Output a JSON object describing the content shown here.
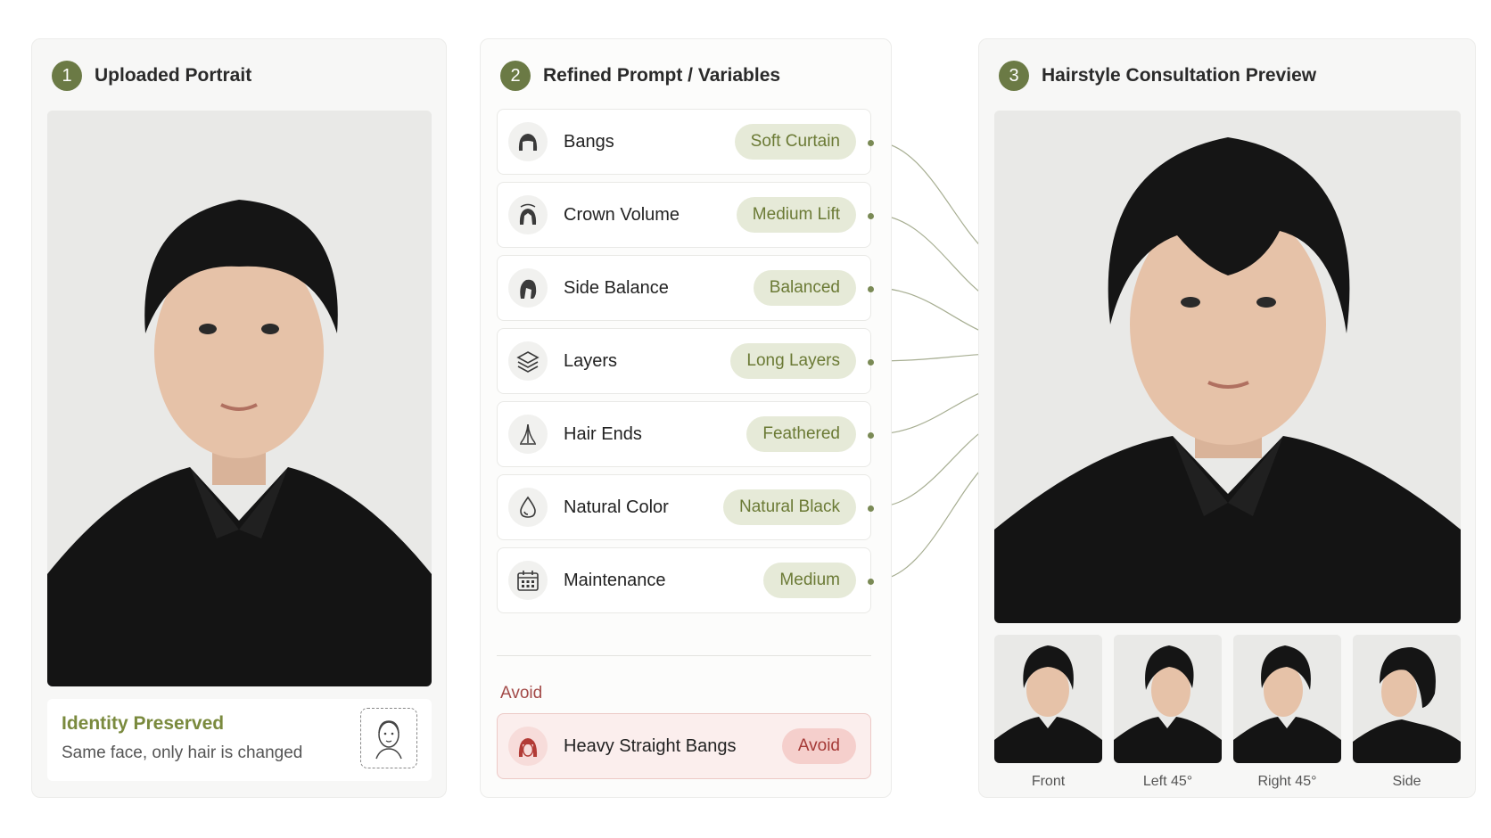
{
  "panels": {
    "upload": {
      "step": "1",
      "title": "Uploaded Portrait"
    },
    "prompt": {
      "step": "2",
      "title": "Refined Prompt / Variables"
    },
    "preview": {
      "step": "3",
      "title": "Hairstyle Consultation Preview"
    }
  },
  "identity": {
    "title": "Identity Preserved",
    "subtitle": "Same face, only hair is changed",
    "icon": "face-outline-icon"
  },
  "variables": [
    {
      "label": "Bangs",
      "value": "Soft Curtain",
      "icon": "bangs-icon"
    },
    {
      "label": "Crown Volume",
      "value": "Medium Lift",
      "icon": "crown-volume-icon"
    },
    {
      "label": "Side Balance",
      "value": "Balanced",
      "icon": "side-balance-icon"
    },
    {
      "label": "Layers",
      "value": "Long Layers",
      "icon": "layers-icon"
    },
    {
      "label": "Hair Ends",
      "value": "Feathered",
      "icon": "hair-ends-icon"
    },
    {
      "label": "Natural Color",
      "value": "Natural Black",
      "icon": "color-drop-icon"
    },
    {
      "label": "Maintenance",
      "value": "Medium",
      "icon": "calendar-icon"
    }
  ],
  "avoid": {
    "heading": "Avoid",
    "label": "Heavy Straight Bangs",
    "value": "Avoid",
    "icon": "heavy-bangs-icon"
  },
  "views": [
    {
      "label": "Front"
    },
    {
      "label": "Left 45°"
    },
    {
      "label": "Right 45°"
    },
    {
      "label": "Side"
    }
  ],
  "colors": {
    "accent": "#6b7a45",
    "chip_bg": "#e6ead8",
    "avoid_text": "#a34a48",
    "avoid_bg": "#fbeeed"
  }
}
